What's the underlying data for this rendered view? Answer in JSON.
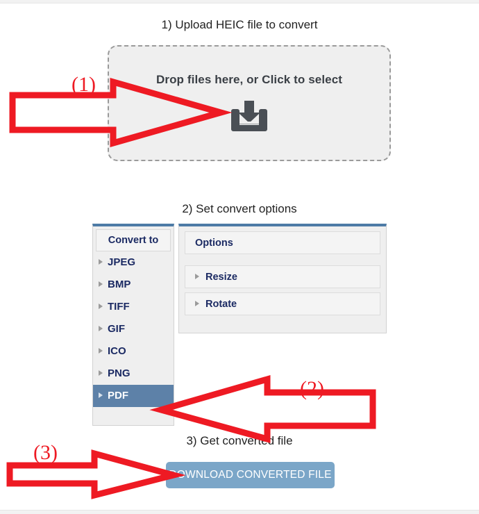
{
  "steps": {
    "step1": "1) Upload HEIC file to convert",
    "step2": "2) Set convert options",
    "step3": "3) Get converted file"
  },
  "dropzone": {
    "label": "Drop files here, or Click to select",
    "icon": "download-tray-icon"
  },
  "convert_panel": {
    "header": "Convert to",
    "formats": [
      {
        "label": "JPEG",
        "selected": false
      },
      {
        "label": "BMP",
        "selected": false
      },
      {
        "label": "TIFF",
        "selected": false
      },
      {
        "label": "GIF",
        "selected": false
      },
      {
        "label": "ICO",
        "selected": false
      },
      {
        "label": "PNG",
        "selected": false
      },
      {
        "label": "PDF",
        "selected": true
      }
    ],
    "selected_format": "PDF"
  },
  "options_panel": {
    "header": "Options",
    "items": [
      {
        "label": "Resize"
      },
      {
        "label": "Rotate"
      }
    ]
  },
  "download": {
    "button_label": "DOWNLOAD CONVERTED FILE"
  },
  "annotations": [
    {
      "id": "1",
      "label": "(1)",
      "target": "dropzone",
      "direction": "right"
    },
    {
      "id": "2",
      "label": "(2)",
      "target": "pdf-format-item",
      "direction": "left"
    },
    {
      "id": "3",
      "label": "(3)",
      "target": "download-button",
      "direction": "right"
    }
  ],
  "colors": {
    "annotation_red": "#ee1a23",
    "panel_accent_blue": "#4d7ba6",
    "selected_item_blue": "#5d81a8",
    "button_blue": "#7ba6c8",
    "heading_navy": "#1b2a63",
    "dropzone_bg": "#efefef",
    "icon_gray": "#4a4f55"
  }
}
